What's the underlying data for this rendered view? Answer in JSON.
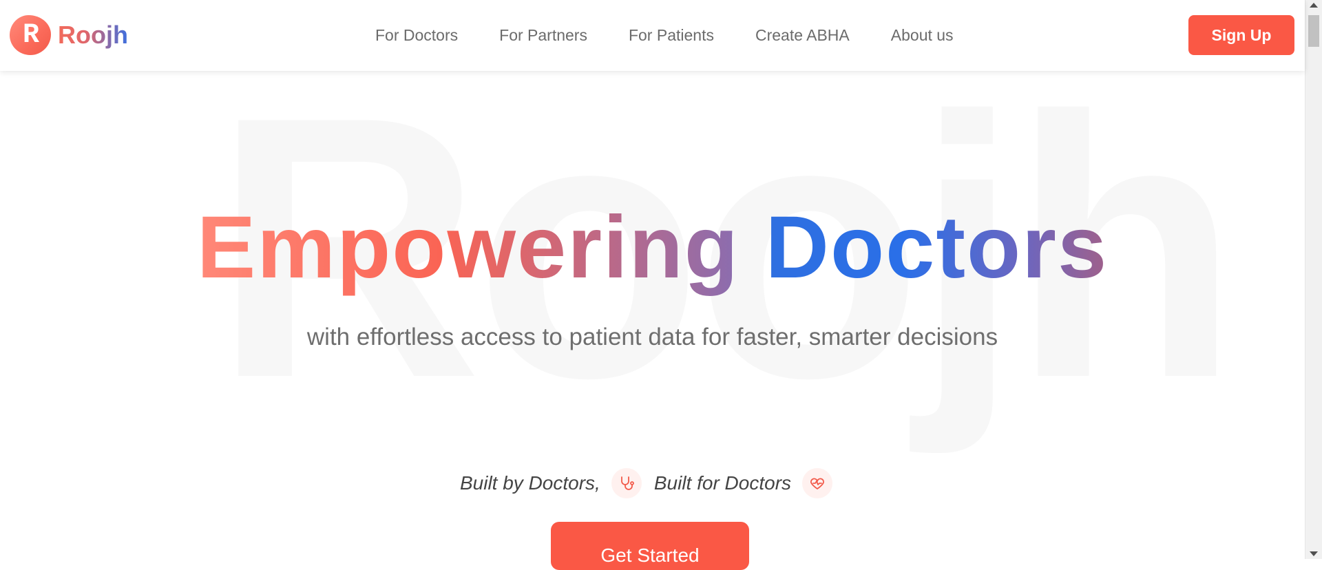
{
  "brand": {
    "name": "Roojh",
    "mark_letter": "R"
  },
  "nav": {
    "links": [
      "For Doctors",
      "For Partners",
      "For Patients",
      "Create ABHA",
      "About us"
    ],
    "signup_label": "Sign Up"
  },
  "hero": {
    "watermark": "Roojh",
    "headline_word1": "Empowering",
    "headline_word2": "Doctors",
    "subtitle": "with effortless access to patient data for faster, smarter decisions",
    "built_by": "Built by Doctors,",
    "built_for": "Built for Doctors",
    "cta_label": "Get Started"
  },
  "colors": {
    "accent": "#fa5845",
    "blue": "#2f6fe0"
  },
  "icons": [
    "stethoscope-icon",
    "heart-pulse-icon"
  ]
}
